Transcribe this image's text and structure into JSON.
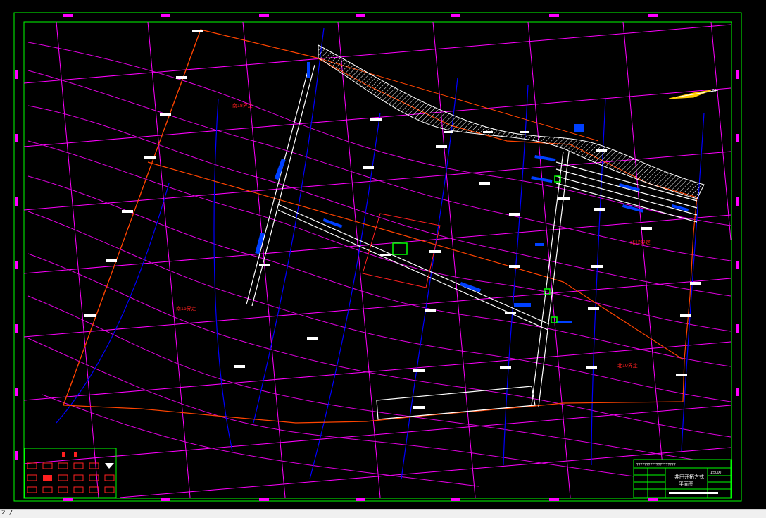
{
  "drawing": {
    "zone_labels": [
      "南18界定",
      "南16界定",
      "北12界定",
      "北10界定"
    ],
    "title_block": {
      "header": "????????????????????",
      "title_line1": "井田开拓方式",
      "title_line2": "平面图",
      "scale": "1:5000"
    },
    "colors": {
      "background": "#000000",
      "frame": "#00ff00",
      "contours": "#ff00ff",
      "boundary": "#ff4400",
      "boreholes": "#0000ff",
      "roadways": "#ffffff",
      "workings": "#0040ff"
    },
    "icons": [
      "north-arrow-icon",
      "hatched-outcrop-icon",
      "legend-symbols-icon"
    ]
  },
  "status": {
    "command_line": "2 /"
  }
}
